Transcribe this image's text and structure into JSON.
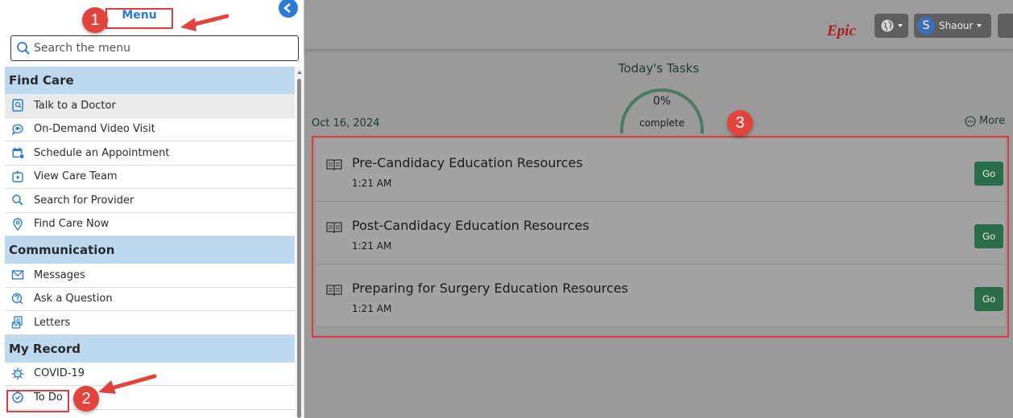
{
  "menu": {
    "title": "Menu",
    "search_placeholder": "Search the menu",
    "sections": [
      {
        "label": "Find Care",
        "items": [
          {
            "label": "Talk to a Doctor",
            "icon": "doctor-chat-icon"
          },
          {
            "label": "On-Demand Video Visit",
            "icon": "video-chat-icon"
          },
          {
            "label": "Schedule an Appointment",
            "icon": "calendar-icon"
          },
          {
            "label": "View Care Team",
            "icon": "care-team-icon"
          },
          {
            "label": "Search for Provider",
            "icon": "search-icon"
          },
          {
            "label": "Find Care Now",
            "icon": "location-pin-icon"
          }
        ]
      },
      {
        "label": "Communication",
        "items": [
          {
            "label": "Messages",
            "icon": "envelope-icon"
          },
          {
            "label": "Ask a Question",
            "icon": "question-bubble-icon"
          },
          {
            "label": "Letters",
            "icon": "letter-icon"
          }
        ]
      },
      {
        "label": "My Record",
        "items": [
          {
            "label": "COVID-19",
            "icon": "virus-icon"
          },
          {
            "label": "To Do",
            "icon": "clock-check-icon"
          }
        ]
      }
    ]
  },
  "annotations": {
    "step1": "1",
    "step2": "2",
    "step3": "3"
  },
  "header": {
    "logo_text": "Epic",
    "user_initial": "S",
    "user_name": "Shaour"
  },
  "tasks": {
    "title": "Today's Tasks",
    "progress_percent": "0%",
    "progress_value": 0,
    "progress_label": "complete",
    "date": "Oct 16, 2024",
    "more_label": "More",
    "items": [
      {
        "name": "Pre-Candidacy Education Resources",
        "time": "1:21 AM",
        "action": "Go"
      },
      {
        "name": "Post-Candidacy Education Resources",
        "time": "1:21 AM",
        "action": "Go"
      },
      {
        "name": "Preparing for Surgery Education Resources",
        "time": "1:21 AM",
        "action": "Go"
      }
    ]
  },
  "colors": {
    "section_bg": "#bcd9f0",
    "annotation_red": "#e2433b",
    "go_button": "#2b6d48",
    "gauge_arc": "#4b7a62"
  }
}
